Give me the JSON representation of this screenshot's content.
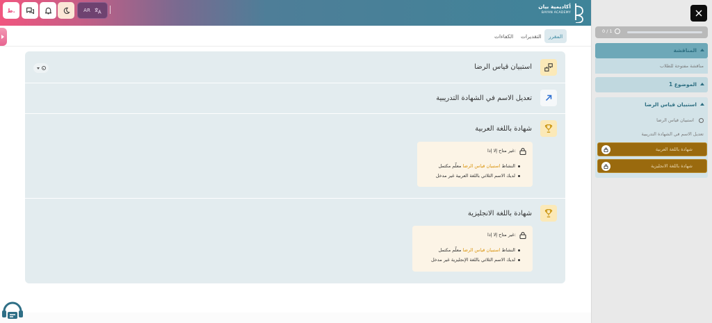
{
  "header": {
    "logo_ar": "أكاديمية بيان",
    "logo_en": "BAYAN ACADEMY",
    "user_initial": "ط.",
    "lang_code": "AR",
    "icons": [
      "user-initial",
      "chat-icon",
      "bell-icon",
      "moon-icon",
      "translate-icon"
    ]
  },
  "tabs": {
    "course": "المقرر",
    "grades": "التقديرات",
    "competencies": "الكفاءات"
  },
  "activities": [
    {
      "title": "استبيان قياس الرضا",
      "icon": "feedback-icon"
    },
    {
      "title": "تعديل الاسم في الشهادة التدريبية",
      "icon": "arrow-up-right-icon"
    },
    {
      "title": "شهادة باللغة العربية",
      "icon": "trophy-icon",
      "restriction": {
        "head": "غير متاح إلا إذا:",
        "line1_prefix": "النشاط",
        "line1_link": "استبيان قياس الرضا",
        "line1_suffix": "معلّم مكتمل",
        "line2": "لديك الاسم الثلاثي باللغة العربية غير مدخل"
      }
    },
    {
      "title": "شهادة باللغة الانجليزية",
      "icon": "trophy-icon",
      "restriction": {
        "head": "غير متاح إلا إذا:",
        "line1_prefix": "النشاط",
        "line1_link": "استبيان قياس الرضا",
        "line1_suffix": "معلّم مكتمل",
        "line2": "لديك الاسم الثلاثي باللغة الإنجليزية غير مدخل"
      }
    }
  ],
  "drawer": {
    "progress_text": "0 / 1",
    "progress_fraction": 0,
    "sections": [
      {
        "title": "المناقشة",
        "items": [
          "مناقشة مفتوحة للطلاب"
        ]
      },
      {
        "title": "الموضوع 1",
        "items": []
      },
      {
        "title": "استبيان قياس الرضا",
        "items": [
          "استبيان قياس الرضا",
          "تعديل الاسم في الشهادة التدريبية"
        ],
        "locked_items": [
          "شهادة باللغة العربية",
          "شهادة باللغة الانجليزية"
        ]
      }
    ]
  },
  "colors": {
    "accent": "#3e8aa3",
    "link_highlight": "#d9940e",
    "locked_bg": "#9a6a0e"
  }
}
